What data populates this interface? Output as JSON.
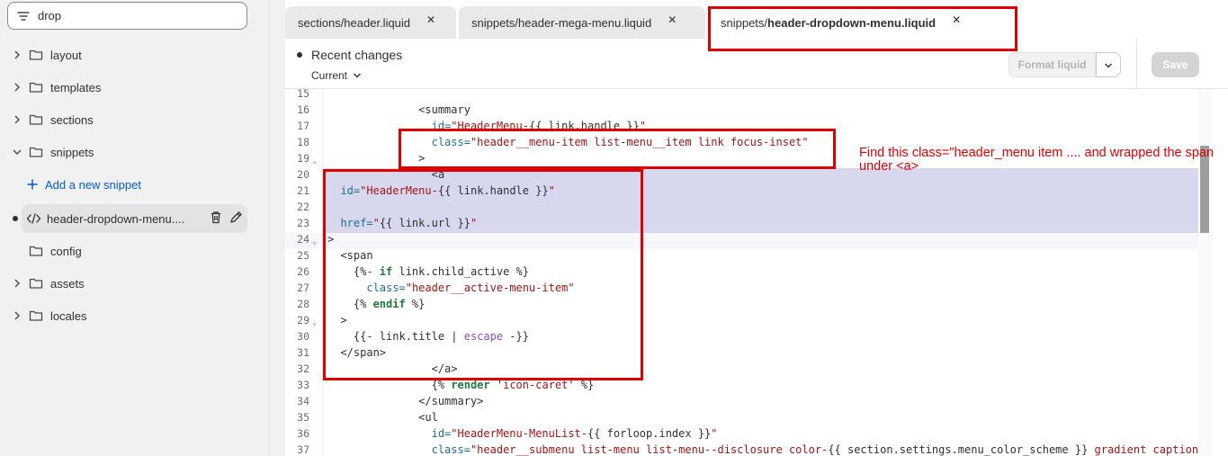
{
  "sidebar": {
    "search_value": "drop",
    "items": [
      {
        "label": "layout"
      },
      {
        "label": "templates"
      },
      {
        "label": "sections"
      },
      {
        "label": "snippets"
      },
      {
        "label": "Add a new snippet"
      },
      {
        "label": "header-dropdown-menu...."
      },
      {
        "label": "config"
      },
      {
        "label": "assets"
      },
      {
        "label": "locales"
      }
    ]
  },
  "tabs": [
    {
      "label": "sections/header.liquid"
    },
    {
      "label": "snippets/header-mega-menu.liquid"
    },
    {
      "label_prefix": "snippets/",
      "label_main": "header-dropdown-menu.liquid"
    }
  ],
  "toolbar": {
    "recent_changes": "Recent changes",
    "current": "Current",
    "format_label": "Format liquid",
    "save_label": "Save"
  },
  "annotation": {
    "text": "Find this class=\"header_menu item .... and wrapped the span under <a>"
  },
  "colors": {
    "annotation_red": "#e00000",
    "selection": "#d7d7ee",
    "link_blue": "#005bd3"
  },
  "code_lines": [
    {
      "n": "15",
      "html": ""
    },
    {
      "n": "16",
      "html": "              &lt;summary"
    },
    {
      "n": "17",
      "html": "                <span class=\"t-attr\">id=</span><span class=\"t-str\">\"HeaderMenu-</span>{{ link.handle }}<span class=\"t-str\">\"</span>"
    },
    {
      "n": "18",
      "html": "                <span class=\"t-attr\">class=</span><span class=\"t-str\">\"header__menu-item list-menu__item link focus-inset\"</span>"
    },
    {
      "n": "19",
      "html": "              &gt;"
    },
    {
      "n": "20",
      "html": "                &lt;a"
    },
    {
      "n": "21",
      "html": "  <span class=\"t-attr\">id=</span><span class=\"t-str\">\"HeaderMenu-</span>{{ link.handle }}<span class=\"t-str\">\"</span>"
    },
    {
      "n": "22",
      "html": ""
    },
    {
      "n": "23",
      "html": "  <span class=\"t-attr\">href=</span><span class=\"t-str\">\"</span>{{ link.url }}<span class=\"t-str\">\"</span>"
    },
    {
      "n": "24",
      "html": "&gt;"
    },
    {
      "n": "25",
      "html": "  &lt;span"
    },
    {
      "n": "26",
      "html": "    {%- <span class=\"t-kw\">if</span> link.child_active %}"
    },
    {
      "n": "27",
      "html": "      <span class=\"t-attr\">class=</span><span class=\"t-str\">\"header__active-menu-item\"</span>"
    },
    {
      "n": "28",
      "html": "    {% <span class=\"t-kw\">endif</span> %}"
    },
    {
      "n": "29",
      "html": "  &gt;"
    },
    {
      "n": "30",
      "html": "    {{- link.title | <span class=\"t-filter\">escape</span> -}}"
    },
    {
      "n": "31",
      "html": "  &lt;/span&gt;"
    },
    {
      "n": "32",
      "html": "                &lt;/a&gt;"
    },
    {
      "n": "33",
      "html": "                {% <span class=\"t-kw\">render</span> <span class=\"t-str\">'icon-caret'</span> %}"
    },
    {
      "n": "34",
      "html": "              &lt;/summary&gt;"
    },
    {
      "n": "35",
      "html": "              &lt;ul"
    },
    {
      "n": "36",
      "html": "                <span class=\"t-attr\">id=</span><span class=\"t-str\">\"HeaderMenu-MenuList-</span>{{ forloop.index }}<span class=\"t-str\">\"</span>"
    },
    {
      "n": "37",
      "html": "                <span class=\"t-attr\">class=</span><span class=\"t-str\">\"header__submenu list-menu list-menu--disclosure color-</span>{{ section.settings.menu_color_scheme }} <span class=\"t-str\">gradient caption-l</span>"
    }
  ]
}
